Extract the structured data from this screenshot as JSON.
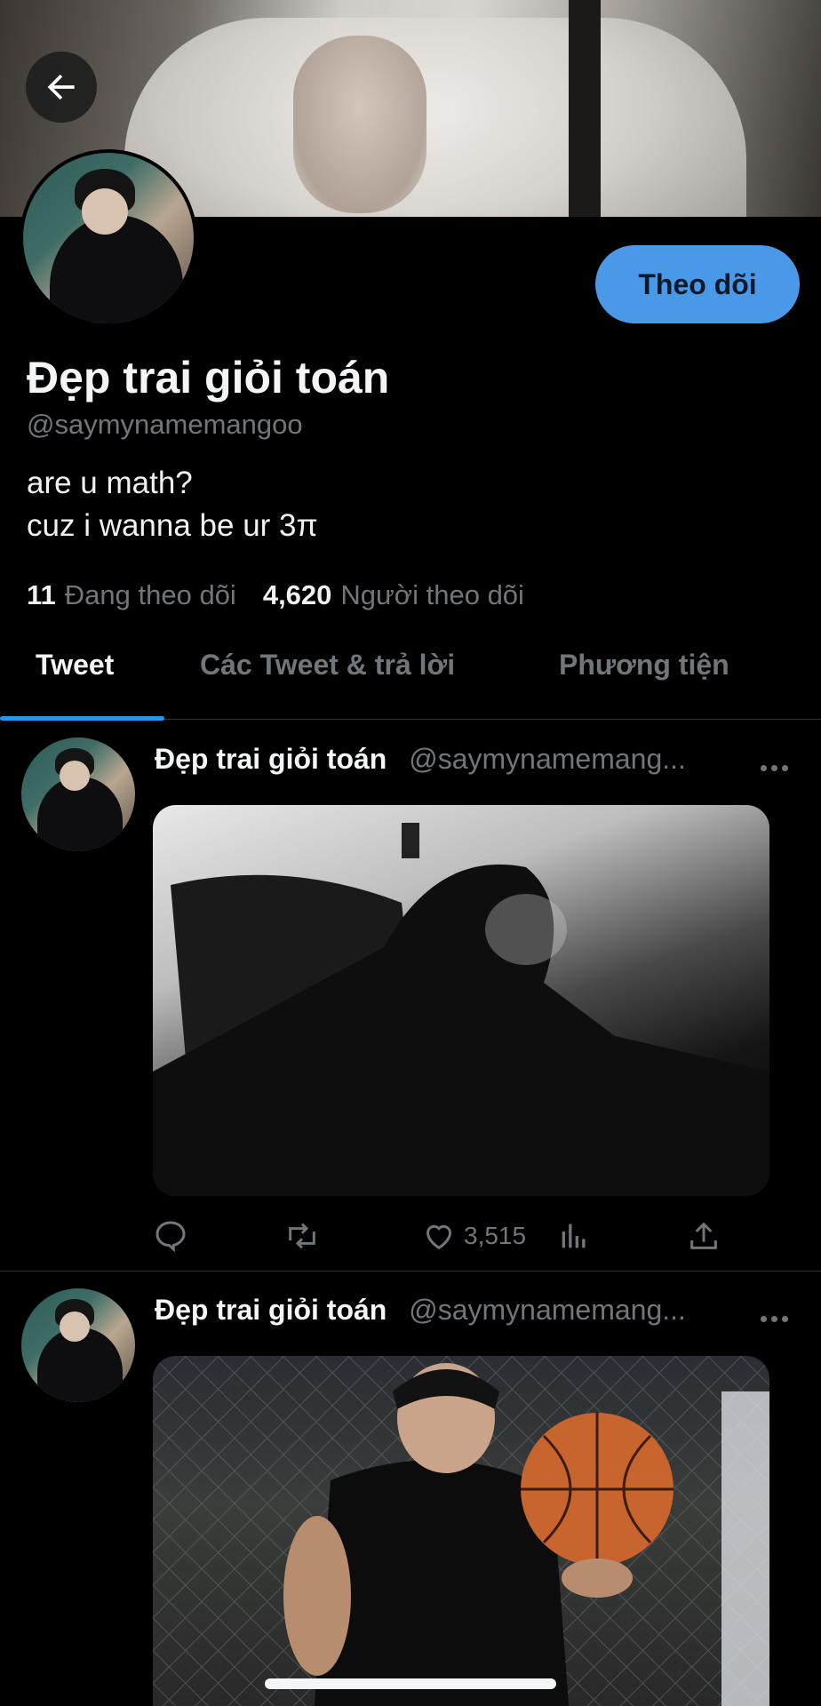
{
  "profile": {
    "display_name": "Đẹp trai giỏi toán",
    "handle": "@saymynamemangoo",
    "bio_line1": "are u math?",
    "bio_line2": "cuz i wanna be ur 3π",
    "following_count": "11",
    "following_label": "Đang theo dõi",
    "followers_count": "4,620",
    "followers_label": "Người theo dõi",
    "follow_button": "Theo dõi"
  },
  "tabs": [
    {
      "label": "Tweet",
      "active": true
    },
    {
      "label": "Các Tweet & trả lời",
      "active": false
    },
    {
      "label": "Phương tiện",
      "active": false
    }
  ],
  "tweets": [
    {
      "name": "Đẹp trai giỏi toán",
      "handle": "@saymynamemang...",
      "likes": "3,515"
    },
    {
      "name": "Đẹp trai giỏi toán",
      "handle": "@saymynamemang..."
    }
  ],
  "icons": {
    "back": "arrow-left-icon",
    "more": "more-horizontal-icon",
    "reply": "reply-icon",
    "retweet": "retweet-icon",
    "like": "heart-icon",
    "views": "views-icon",
    "share": "share-icon"
  },
  "colors": {
    "accent": "#1d9bf0",
    "follow_button_bg": "#4a99e9",
    "muted_text": "#71767b",
    "background": "#000000"
  }
}
